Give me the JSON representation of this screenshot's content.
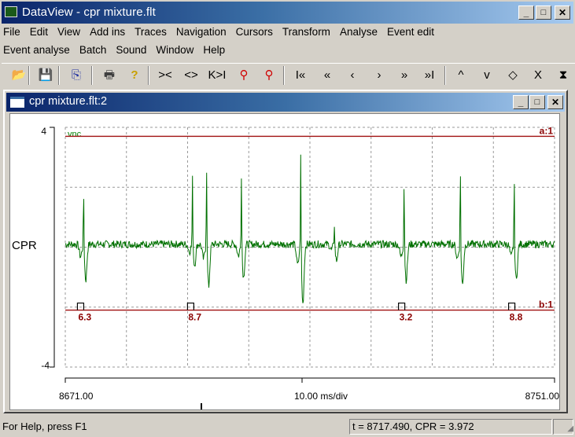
{
  "app": {
    "title": "DataView - cpr mixture.flt",
    "window_buttons": {
      "minimize": "_",
      "maximize": "□",
      "close": "✕"
    }
  },
  "menu": {
    "row1": [
      "File",
      "Edit",
      "View",
      "Add ins",
      "Traces",
      "Navigation",
      "Cursors",
      "Transform",
      "Analyse",
      "Event edit"
    ],
    "row2": [
      "Event analyse",
      "Batch",
      "Sound",
      "Window",
      "Help"
    ]
  },
  "toolbar": {
    "buttons": [
      {
        "name": "open-folder",
        "glyph": "📂"
      },
      {
        "name": "save",
        "glyph": "💾"
      },
      {
        "name": "copy",
        "glyph": "⎘"
      },
      {
        "name": "print",
        "glyph": "🖶"
      },
      {
        "name": "help",
        "glyph": "?"
      },
      {
        "name": "zoom-in-time",
        "glyph": "><"
      },
      {
        "name": "zoom-out-time",
        "glyph": "<>"
      },
      {
        "name": "fit-time",
        "glyph": "K>I"
      },
      {
        "name": "zoom-horizontal",
        "glyph": "⚲"
      },
      {
        "name": "zoom-vertical",
        "glyph": "⚲"
      },
      {
        "name": "go-start",
        "glyph": "I«"
      },
      {
        "name": "page-back",
        "glyph": "«"
      },
      {
        "name": "step-back",
        "glyph": "‹"
      },
      {
        "name": "step-forward",
        "glyph": "›"
      },
      {
        "name": "page-forward",
        "glyph": "»"
      },
      {
        "name": "go-end",
        "glyph": "»I"
      },
      {
        "name": "scale-up",
        "glyph": "^"
      },
      {
        "name": "scale-down",
        "glyph": "v"
      },
      {
        "name": "expand-vertical",
        "glyph": "◇"
      },
      {
        "name": "compress-vertical",
        "glyph": "X"
      },
      {
        "name": "fit-vertical",
        "glyph": "⧗"
      }
    ]
  },
  "child_window": {
    "title": "cpr mixture.flt:2"
  },
  "chart_data": {
    "type": "line",
    "trace_name": "CPR",
    "trace_label": "vnc",
    "yaxis": {
      "top_label": "4",
      "bottom_label": "-4",
      "ylim": [
        -4,
        4
      ]
    },
    "xaxis": {
      "start_label": "8671.00",
      "end_label": "8751.00",
      "scale_label": "10.00 ms/div",
      "xlim": [
        8671,
        8751
      ]
    },
    "cursor_a": {
      "label": "a:1",
      "value": 3.7
    },
    "cursor_b": {
      "label": "b:1",
      "value": -2.1
    },
    "events": [
      {
        "t": 8673.5,
        "label": "6.3"
      },
      {
        "t": 8691.5,
        "label": "8.7"
      },
      {
        "t": 8726.0,
        "label": "3.2"
      },
      {
        "t": 8744.0,
        "label": "8.8"
      }
    ],
    "spikes": [
      {
        "t": 8674.0,
        "peak": 1.95,
        "trough": -1.2
      },
      {
        "t": 8691.8,
        "peak": 2.3,
        "trough": -0.7
      },
      {
        "t": 8694.1,
        "peak": 2.8,
        "trough": -1.4
      },
      {
        "t": 8699.8,
        "peak": 2.5,
        "trough": -1.1
      },
      {
        "t": 8709.5,
        "peak": 3.3,
        "trough": -2.0
      },
      {
        "t": 8715.0,
        "peak": 0.75,
        "trough": -0.55
      },
      {
        "t": 8726.4,
        "peak": 2.3,
        "trough": -1.2
      },
      {
        "t": 8735.6,
        "peak": 2.8,
        "trough": -1.35
      },
      {
        "t": 8744.4,
        "peak": 2.35,
        "trough": -1.2
      }
    ],
    "baseline": 0.1,
    "color": "#007000"
  },
  "status": {
    "help": "For Help, press F1",
    "readout": "t = 8717.490, CPR = 3.972"
  }
}
